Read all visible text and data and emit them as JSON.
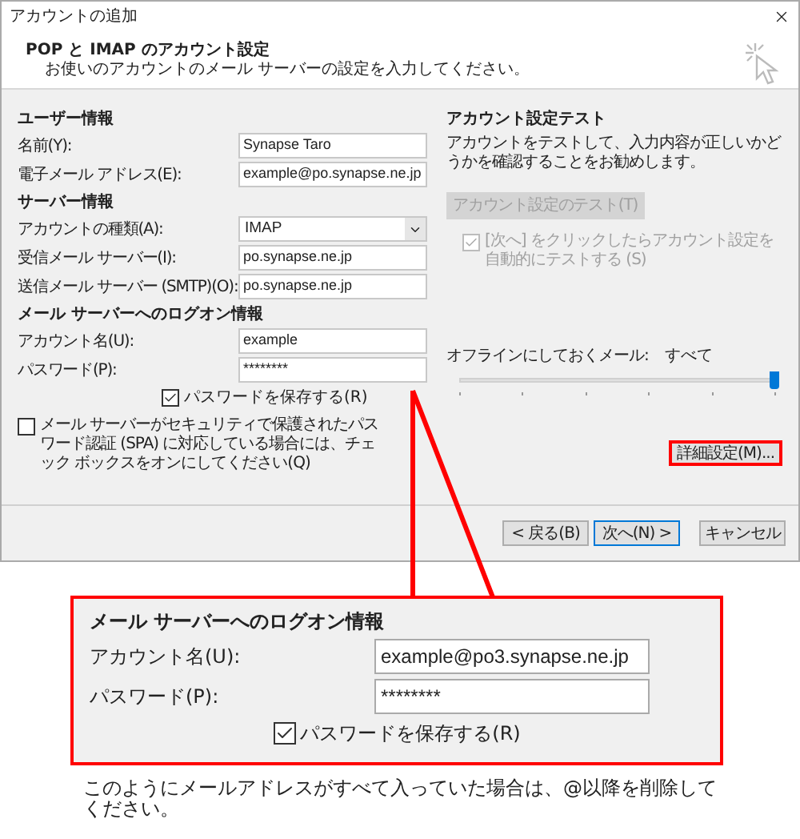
{
  "window": {
    "title": "アカウントの追加"
  },
  "header": {
    "title": "POP と IMAP のアカウント設定",
    "subtitle": "お使いのアカウントのメール サーバーの設定を入力してください。"
  },
  "user_info": {
    "heading": "ユーザー情報",
    "fields": [
      {
        "label": "名前(Y):",
        "value": "Synapse Taro",
        "kind": "text"
      },
      {
        "label": "電子メール アドレス(E):",
        "value": "example@po.synapse.ne.jp",
        "kind": "text"
      }
    ]
  },
  "server_info": {
    "heading": "サーバー情報",
    "fields": [
      {
        "label": "アカウントの種類(A):",
        "value": "IMAP",
        "kind": "dropdown"
      },
      {
        "label": "受信メール サーバー(I):",
        "value": "po.synapse.ne.jp",
        "kind": "text"
      },
      {
        "label": "送信メール サーバー (SMTP)(O):",
        "value": "po.synapse.ne.jp",
        "kind": "text"
      }
    ]
  },
  "logon_info": {
    "heading": "メール サーバーへのログオン情報",
    "fields": [
      {
        "label": "アカウント名(U):",
        "value": "example",
        "kind": "text"
      },
      {
        "label": "パスワード(P):",
        "value": "********",
        "kind": "text"
      }
    ],
    "remember_password": {
      "label": "パスワードを保存する(R)",
      "checked": true
    }
  },
  "spa": {
    "label": "メール サーバーがセキュリティで保護されたパスワード認証 (SPA) に対応している場合には、チェック ボックスをオンにしてください(Q)",
    "checked": false
  },
  "test": {
    "heading": "アカウント設定テスト",
    "description": "アカウントをテストして、入力内容が正しいかどうかを確認することをお勧めします。",
    "button": {
      "label": "アカウント設定のテスト(T)",
      "disabled": true
    },
    "auto_test": {
      "label": "[次へ] をクリックしたらアカウント設定を自動的にテストする (S)",
      "checked": true,
      "disabled": true
    }
  },
  "offline": {
    "label": "オフラインにしておくメール:",
    "value": "すべて",
    "level": 1
  },
  "advanced_button": {
    "label": "詳細設定(M)...",
    "highlighted": true
  },
  "buttons": [
    {
      "label": "< 戻る(B)",
      "default": false
    },
    {
      "label": "次へ(N) >",
      "default": true
    },
    {
      "label": "キャンセル",
      "default": false
    }
  ],
  "callout": {
    "heading": "メール サーバーへのログオン情報",
    "fields": [
      {
        "label": "アカウント名(U):",
        "value": "example@po3.synapse.ne.jp"
      },
      {
        "label": "パスワード(P):",
        "value": "********"
      }
    ],
    "remember_password": {
      "label": "パスワードを保存する(R)",
      "checked": true
    }
  },
  "note": "このようにメールアドレスがすべて入っていた場合は、@以降を削除してください。"
}
